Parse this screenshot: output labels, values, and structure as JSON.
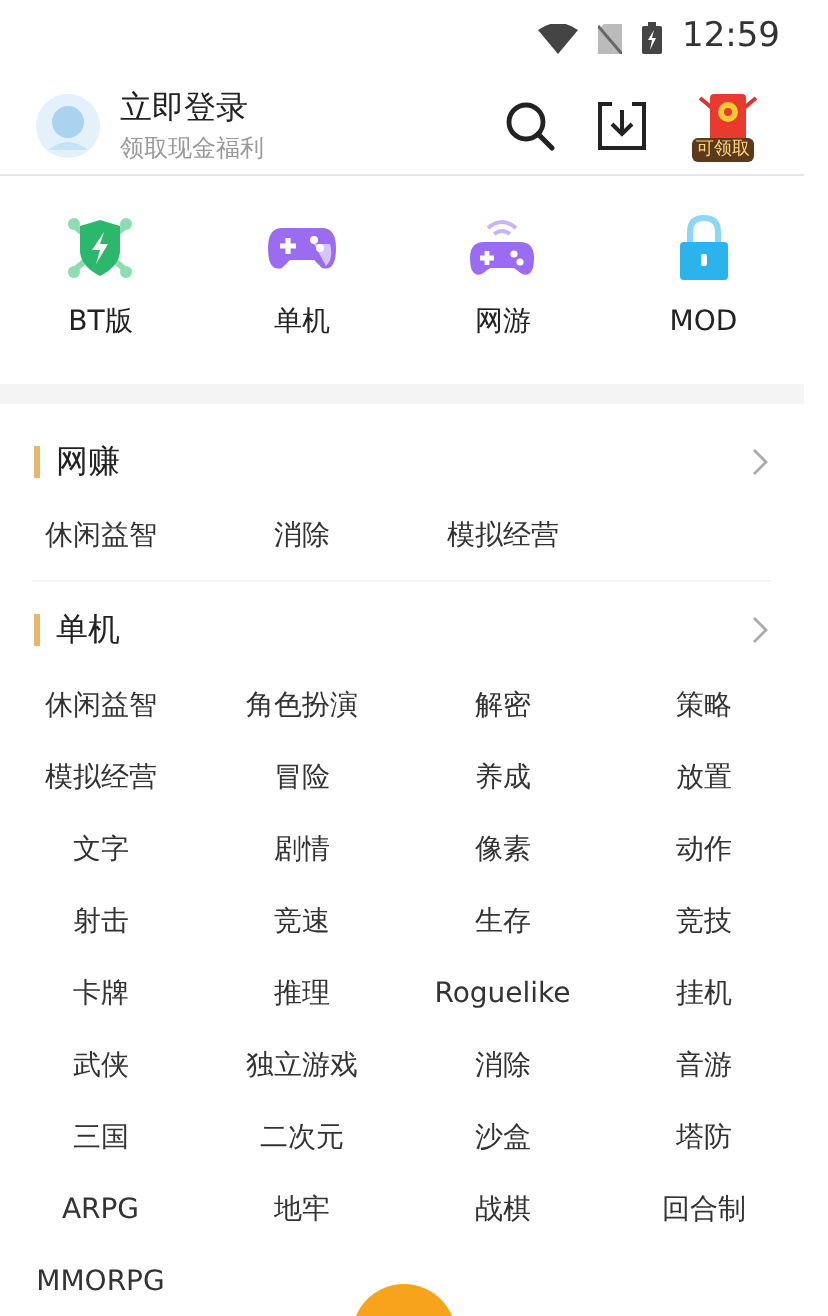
{
  "status_bar": {
    "time": "12:59"
  },
  "header": {
    "title": "立即登录",
    "subtitle": "领取现金福利",
    "reward_badge": "可领取"
  },
  "categories": [
    {
      "label": "BT版",
      "kind": "shield"
    },
    {
      "label": "单机",
      "kind": "gamepad"
    },
    {
      "label": "网游",
      "kind": "online"
    },
    {
      "label": "MOD",
      "kind": "lock"
    }
  ],
  "sections": [
    {
      "title": "网赚",
      "tags": [
        "休闲益智",
        "消除",
        "模拟经营"
      ]
    },
    {
      "title": "单机",
      "tags": [
        "休闲益智",
        "角色扮演",
        "解密",
        "策略",
        "模拟经营",
        "冒险",
        "养成",
        "放置",
        "文字",
        "剧情",
        "像素",
        "动作",
        "射击",
        "竞速",
        "生存",
        "竞技",
        "卡牌",
        "推理",
        "Roguelike",
        "挂机",
        "武侠",
        "独立游戏",
        "消除",
        "音游",
        "三国",
        "二次元",
        "沙盒",
        "塔防",
        "ARPG",
        "地牢",
        "战棋",
        "回合制",
        "MMORPG"
      ]
    }
  ]
}
